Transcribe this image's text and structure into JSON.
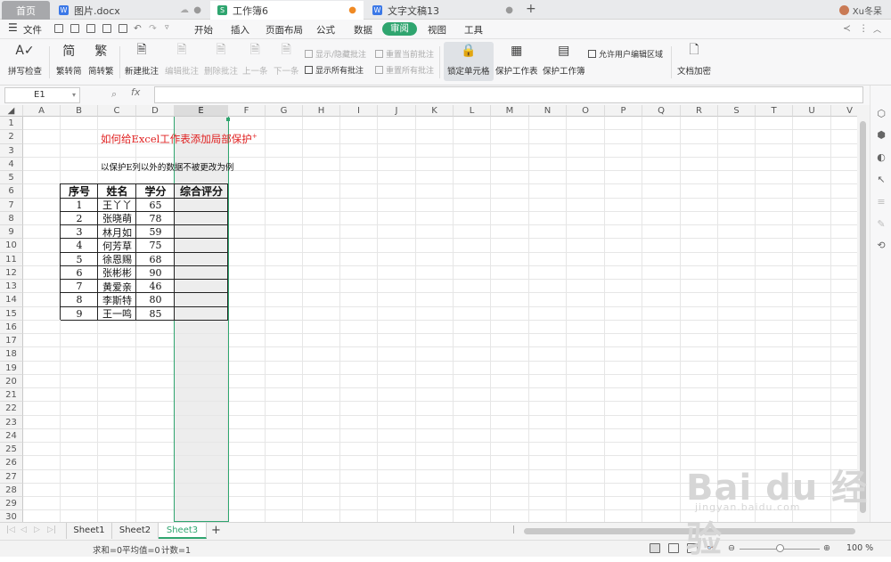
{
  "tabs": [
    {
      "label": "首页",
      "kind": "home"
    },
    {
      "label": "图片.docx",
      "kind": "doc",
      "icon": "W",
      "color": "#3b78e7"
    },
    {
      "label": "工作簿6",
      "kind": "sheet",
      "icon": "S",
      "color": "#2fa56f"
    },
    {
      "label": "文字文稿13",
      "kind": "doc",
      "icon": "W",
      "color": "#3b78e7"
    }
  ],
  "user": "Xu冬呆",
  "menu": {
    "file": "文件",
    "items": [
      "开始",
      "插入",
      "页面布局",
      "公式",
      "数据",
      "审阅",
      "视图",
      "工具"
    ],
    "active": "审阅"
  },
  "ribbon": {
    "spell": "拼写检查",
    "trad": "繁转简",
    "simp": "简转繁",
    "newc": "新建批注",
    "editc": "编辑批注",
    "delc": "删除批注",
    "prev": "上一条",
    "next": "下一条",
    "showhide": "显示/隐藏批注",
    "showall": "显示所有批注",
    "resetcur": "重置当前批注",
    "resetall": "重置所有批注",
    "lock": "锁定单元格",
    "protsheet": "保护工作表",
    "protbook": "保护工作簿",
    "allowedit": "允许用户编辑区域",
    "encrypt": "文档加密"
  },
  "namebox": "E1",
  "fx": "fx",
  "columns": [
    "A",
    "B",
    "C",
    "D",
    "E",
    "F",
    "G",
    "H",
    "I",
    "J",
    "K",
    "L",
    "M",
    "N",
    "O",
    "P",
    "Q",
    "R",
    "S",
    "T",
    "U",
    "V"
  ],
  "rows": [
    "1",
    "2",
    "3",
    "4",
    "5",
    "6",
    "7",
    "8",
    "9",
    "10",
    "11",
    "12",
    "13",
    "14",
    "15",
    "16",
    "17",
    "18",
    "19",
    "20",
    "21",
    "22",
    "23",
    "24",
    "25",
    "26",
    "27",
    "28",
    "29",
    "30"
  ],
  "sheet": {
    "title": "如何给Excel工作表添加局部保护",
    "title_sup": "+",
    "note": "以保护E列以外的数据不被更改为例",
    "headers": [
      "序号",
      "姓名",
      "学分",
      "综合评分"
    ],
    "data": [
      [
        "1",
        "王丫丫",
        "65"
      ],
      [
        "2",
        "张晓萌",
        "78"
      ],
      [
        "3",
        "林月如",
        "59"
      ],
      [
        "4",
        "何芳草",
        "75"
      ],
      [
        "5",
        "徐恩赐",
        "68"
      ],
      [
        "6",
        "张彬彬",
        "90"
      ],
      [
        "7",
        "黄爱亲",
        "46"
      ],
      [
        "8",
        "李斯特",
        "80"
      ],
      [
        "9",
        "王一鸣",
        "85"
      ]
    ]
  },
  "sheets": [
    "Sheet1",
    "Sheet2",
    "Sheet3"
  ],
  "active_sheet": "Sheet3",
  "status": {
    "sum": "求和=0",
    "avg": "平均值=0",
    "count": "计数=1",
    "zoom": "100 %"
  },
  "watermark": {
    "main": "Bai du 经验",
    "sub": "jingyan.baidu.com"
  },
  "accent": "#2fa56f"
}
